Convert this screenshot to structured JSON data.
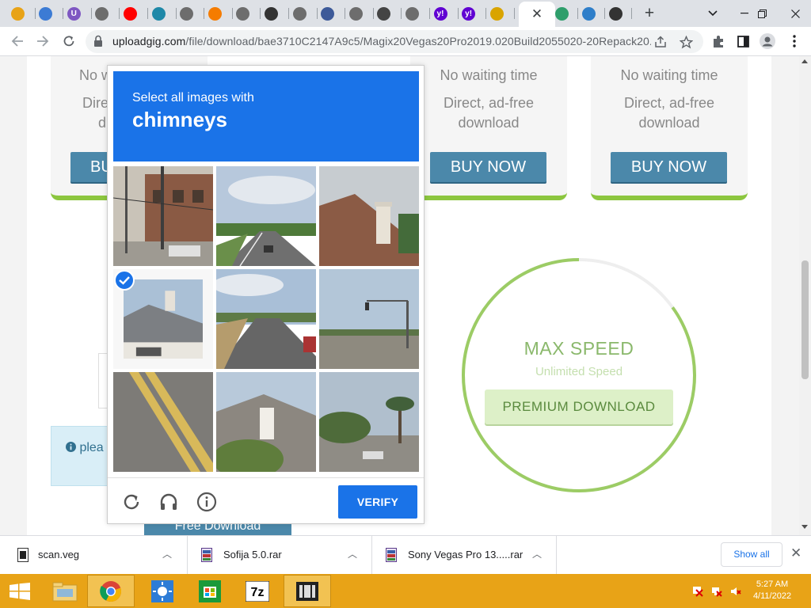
{
  "browser": {
    "tabs": [
      {
        "icon": "chrome-icon",
        "color": "#e8a317"
      },
      {
        "icon": "shield-tab-icon",
        "color": "#3c7bd4"
      },
      {
        "icon": "u-tab-icon",
        "color": "#7e57c2",
        "glyph": "U"
      },
      {
        "icon": "globe-icon",
        "color": "#6d6d6d"
      },
      {
        "icon": "youtube-icon",
        "color": "#ff0000"
      },
      {
        "icon": "download-tab-icon",
        "color": "#1e88a8"
      },
      {
        "icon": "globe-icon",
        "color": "#6d6d6d"
      },
      {
        "icon": "diamond-tab-icon",
        "color": "#f57c00"
      },
      {
        "icon": "globe-icon",
        "color": "#6d6d6d"
      },
      {
        "icon": "bar-tab-icon",
        "color": "#333333"
      },
      {
        "icon": "globe-icon",
        "color": "#6d6d6d"
      },
      {
        "icon": "card-tab-icon",
        "color": "#3d5a99"
      },
      {
        "icon": "globe-icon",
        "color": "#6d6d6d"
      },
      {
        "icon": "crosshair-tab-icon",
        "color": "#444444"
      },
      {
        "icon": "globe-icon",
        "color": "#6d6d6d"
      },
      {
        "icon": "yahoo-icon",
        "color": "#6001d2",
        "glyph": "y!"
      },
      {
        "icon": "yahoo-icon",
        "color": "#6001d2",
        "glyph": "y!"
      },
      {
        "icon": "arrow-tab-icon",
        "color": "#d9a400"
      }
    ],
    "active_tab_close": "✕",
    "after_tabs": [
      {
        "icon": "leaf-tab-icon",
        "color": "#2e9e6b"
      },
      {
        "icon": "chevron-tab-icon",
        "color": "#2e7ec9"
      },
      {
        "icon": "moon-tab-icon",
        "color": "#333333"
      }
    ],
    "new_tab": "+",
    "url_host": "uploadgig.com",
    "url_path": "/file/download/bae3710C2147A9c5/Magix20Vegas20Pro2019.020Build2055020-20Repack20..."
  },
  "page": {
    "plans": [
      {
        "line1": "No waiting time",
        "line2a": "Direct, ad-free",
        "line2b": "download",
        "button": "BUY NOW"
      },
      {
        "line1": "No waiting time",
        "line2a": "Direct, ad-free",
        "line2b": "download",
        "button": "BUY NOW"
      },
      {
        "line1": "No waiting time",
        "line2a": "Direct, ad-free",
        "line2b": "download",
        "button": "BUY NOW"
      }
    ],
    "partial_left_plan": {
      "line1": "No w",
      "line2a": "Dire",
      "line2b": "d",
      "button": "BU"
    },
    "speed_title": "MAX SPEED",
    "speed_subtitle": "Unlimited Speed",
    "premium_button": "PREMIUM DOWNLOAD",
    "speed_ring_fill": 0.85,
    "info_text": "plea",
    "free_download": "Free Download"
  },
  "captcha": {
    "prompt": "Select all images with",
    "target": "chimneys",
    "selected_tile": 3,
    "verify_label": "VERIFY",
    "colors": {
      "header": "#1a73e8",
      "verify": "#1a73e8"
    }
  },
  "downloads": {
    "items": [
      {
        "name": "scan.veg",
        "icon": "file-icon"
      },
      {
        "name": "Sofija 5.0.rar",
        "icon": "rar-icon"
      },
      {
        "name": "Sony Vegas Pro 13.....rar",
        "icon": "rar-icon"
      }
    ],
    "show_all": "Show all"
  },
  "taskbar": {
    "time": "5:27 AM",
    "date": "4/11/2022"
  }
}
